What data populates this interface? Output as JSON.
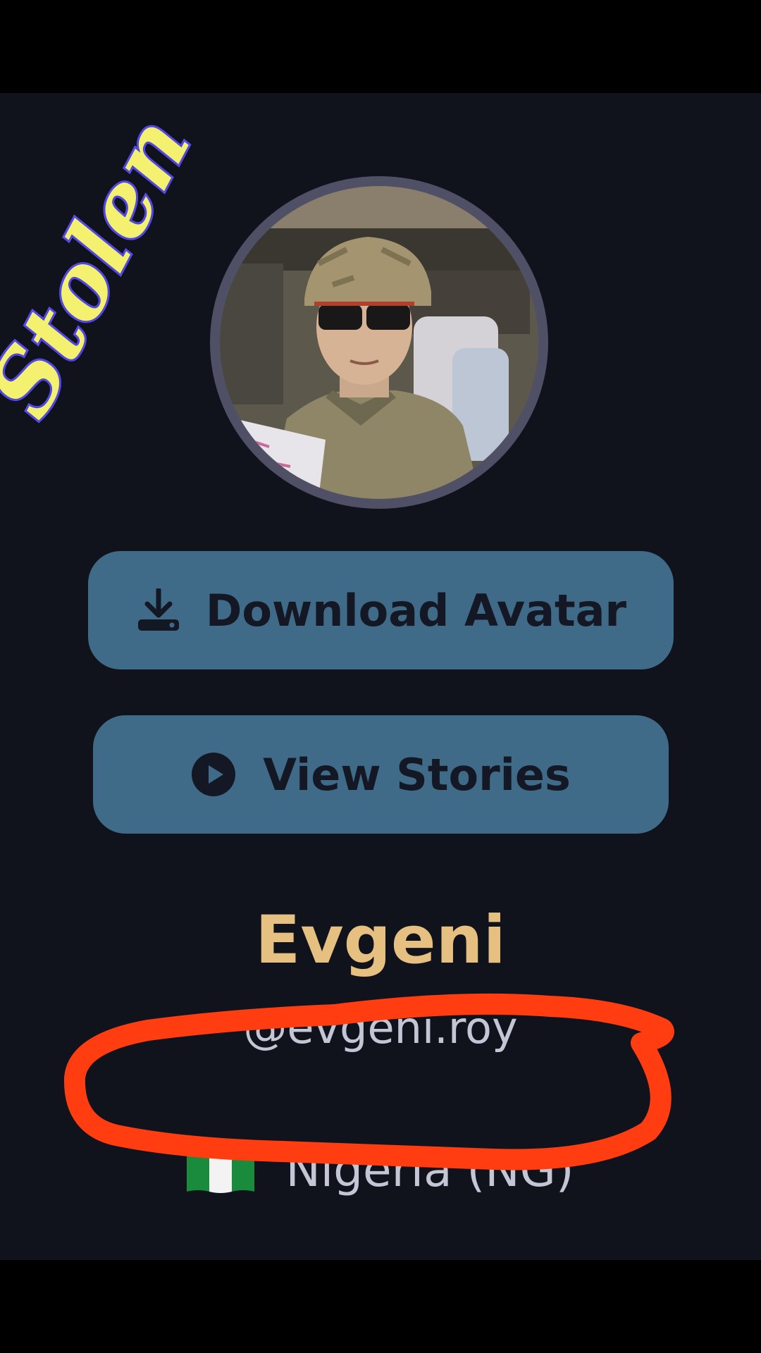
{
  "profile": {
    "display_name": "Evgeni",
    "username": "@evgeni.roy",
    "country": "Nigeria (NG)",
    "flag_icon": "nigeria-flag-icon",
    "privacy_icon": "lock-icon"
  },
  "actions": {
    "download_label": "Download Avatar",
    "download_icon": "download-icon",
    "stories_label": "View Stories",
    "stories_icon": "play-circle-icon"
  },
  "overlay": {
    "stamp_text": "Stolen"
  },
  "colors": {
    "background": "#10121c",
    "button": "#3f6b88",
    "name": "#e6c080",
    "secondary_text": "#c4c6d6",
    "annotation": "#ff3d10"
  }
}
